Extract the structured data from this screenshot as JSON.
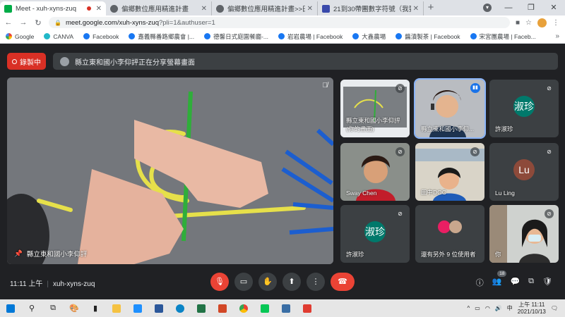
{
  "browser": {
    "tabs": [
      {
        "title": "Meet - xuh-xyns-zuq",
        "active": true
      },
      {
        "title": "偏鄉數位應用精進計畫",
        "active": false
      },
      {
        "title": "偏鄉數位應用精進計畫>>田中DOC",
        "active": false
      },
      {
        "title": "21到30帶團數字符號（我要戲劇",
        "active": false
      }
    ],
    "url_host": "meet.google.com/xuh-xyns-zuq",
    "url_path": "?pli=1&authuser=1",
    "bookmarks": [
      "Google",
      "CANVA",
      "Facebook",
      "嘉義縣番路鄉農會 |...",
      "德馨日式庭園餐廳-...",
      "岩岩農場 | Facebook",
      "大鑫農場",
      "醬漬製茶 | Facebook",
      "宋宮團農場 | Faceb..."
    ]
  },
  "meet": {
    "record_label": "錄製中",
    "presenting_text": "縣立東和國小李仰評正在分享螢幕畫面",
    "main_name": "縣立東和國小李仰評",
    "tiles": [
      {
        "name": "縣立東和國小李仰評",
        "sub": "(你的畫面)",
        "kind": "screen"
      },
      {
        "name": "縣立東和國小李仰...",
        "kind": "cam",
        "speaking": true
      },
      {
        "name": "許淑珍",
        "initial": "淑珍",
        "color": "#00796b",
        "kind": "avatar"
      },
      {
        "name": "Sway Chen",
        "kind": "cam"
      },
      {
        "name": "田中DOC",
        "kind": "cam"
      },
      {
        "name": "Lu Ling",
        "initial": "Lu",
        "color": "#8d4a3a",
        "kind": "avatar"
      },
      {
        "name": "許淑珍",
        "initial": "淑珍",
        "color": "#00796b",
        "kind": "avatar"
      },
      {
        "name": "還有另外 9 位使用者",
        "kind": "more"
      },
      {
        "name": "你",
        "kind": "cam"
      }
    ],
    "time": "11:11 上午",
    "meeting_code": "xuh-xyns-zuq",
    "people_count": "18"
  },
  "taskbar": {
    "clock_time": "上午 11:11",
    "clock_date": "2021/10/13",
    "ime": "中"
  }
}
